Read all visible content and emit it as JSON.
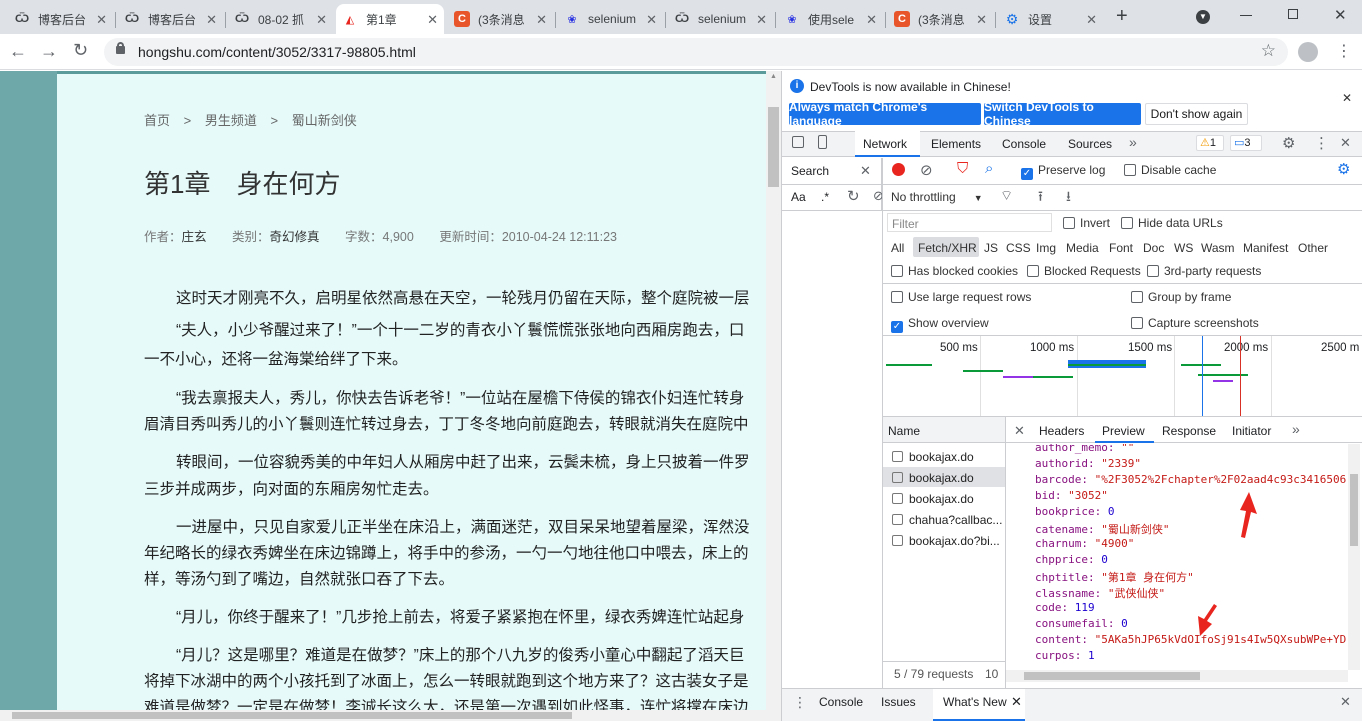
{
  "browser": {
    "tabs": [
      {
        "label": "博客后台",
        "icon": "csdn-w-icon"
      },
      {
        "label": "博客后台",
        "icon": "csdn-w-icon"
      },
      {
        "label": "08-02 抓",
        "icon": "csdn-w-icon"
      },
      {
        "label": "第1章",
        "icon": "hongshu-icon"
      },
      {
        "label": "(3条消息",
        "icon": "csdn-c-icon"
      },
      {
        "label": "selenium",
        "icon": "baidu-paw-icon"
      },
      {
        "label": "selenium",
        "icon": "csdn-w-icon"
      },
      {
        "label": "使用sele",
        "icon": "baidu-paw-icon"
      },
      {
        "label": "(3条消息",
        "icon": "csdn-c-icon"
      },
      {
        "label": "设置",
        "icon": "gear-icon"
      }
    ],
    "url": "hongshu.com/content/3052/3317-98805.html"
  },
  "page": {
    "breadcrumb": [
      "首页",
      "男生频道",
      "蜀山新剑侠"
    ],
    "breadcrumb_sep": ">",
    "title": "第1章　身在何方",
    "meta": {
      "author_label": "作者：",
      "author": "庄玄",
      "category_label": "类别：",
      "category": "奇幻修真",
      "words_label": "字数：",
      "words": "4,900",
      "updated_label": "更新时间：",
      "updated": "2010-04-24 12:11:23"
    },
    "lines": [
      "这时天才刚亮不久，启明星依然高悬在天空，一轮残月仍留在天际，整个庭院被一层",
      "“夫人，小少爷醒过来了！”一个十一二岁的青衣小丫鬟慌慌张张地向西厢房跑去，口",
      "一不小心，还将一盆海棠给绊了下来。",
      "“我去禀报夫人，秀儿，你快去告诉老爷！”一位站在屋檐下侍侯的锦衣仆妇连忙转身",
      "眉清目秀叫秀儿的小丫鬟则连忙转过身去，丁丁冬冬地向前庭跑去，转眼就消失在庭院中",
      "转眼间，一位容貌秀美的中年妇人从厢房中赶了出来，云鬓未梳，身上只披着一件罗",
      "三步并成两步，向对面的东厢房匆忙走去。",
      "一进屋中，只见自家爱儿正半坐在床沿上，满面迷茫，双目呆呆地望着屋梁，浑然没",
      "年纪略长的绿衣秀婢坐在床边锦蹲上，将手中的参汤，一勺一勺地往他口中喂去，床上的",
      "样，等汤勺到了嘴边，自然就张口吞了下去。",
      "“月儿，你终于醒来了！”几步抢上前去，将爱子紧紧抱在怀里，绿衣秀婢连忙站起身",
      "“月儿？这是哪里？难道是在做梦？”床上的那个八九岁的俊秀小童心中翻起了滔天巨",
      "将掉下冰湖中的两个小孩托到了冰面上，怎么一转眼就跑到这个地方来了？这古装女子是",
      "难道是做梦？一定是在做梦！李诚长这么大，还是第一次遇到如此怪事，连忙将撑在床边"
    ]
  },
  "devtools": {
    "banner": {
      "text": "DevTools is now available in Chinese!",
      "btn1": "Always match Chrome's language",
      "btn2": "Switch DevTools to Chinese",
      "btn3": "Don't show again"
    },
    "tabs": [
      "Network",
      "Elements",
      "Console",
      "Sources"
    ],
    "warn_count": "1",
    "msg_count": "3",
    "search_label": "Search",
    "search_aa": "Aa",
    "search_regex": ".*",
    "preserve_log": "Preserve log",
    "disable_cache": "Disable cache",
    "throttling": "No throttling",
    "filter_placeholder": "Filter",
    "invert": "Invert",
    "hide_data_urls": "Hide data URLs",
    "types": [
      "All",
      "Fetch/XHR",
      "JS",
      "CSS",
      "Img",
      "Media",
      "Font",
      "Doc",
      "WS",
      "Wasm",
      "Manifest",
      "Other"
    ],
    "has_blocked_cookies": "Has blocked cookies",
    "blocked_requests": "Blocked Requests",
    "third_party": "3rd-party requests",
    "large_rows": "Use large request rows",
    "group_by_frame": "Group by frame",
    "show_overview": "Show overview",
    "capture_screenshots": "Capture screenshots",
    "timeline_ticks": [
      "500 ms",
      "1000 ms",
      "1500 ms",
      "2000 ms",
      "2500 m"
    ],
    "name_header": "Name",
    "requests": [
      "bookajax.do",
      "bookajax.do",
      "bookajax.do",
      "chahua?callbac...",
      "bookajax.do?bi..."
    ],
    "status": "5 / 79 requests",
    "status2": "10",
    "detail_tabs": [
      "Headers",
      "Preview",
      "Response",
      "Initiator"
    ],
    "json": [
      {
        "k": "author_memo: ",
        "v": "\"\""
      },
      {
        "k": "authorid: ",
        "v": "\"2339\""
      },
      {
        "k": "barcode: ",
        "v": "\"%2F3052%2Fchapter%2F02aad4c93c3416506"
      },
      {
        "k": "bid: ",
        "v": "\"3052\""
      },
      {
        "k": "bookprice: ",
        "v": "0"
      },
      {
        "k": "catename: ",
        "v": "\"蜀山新剑侠\""
      },
      {
        "k": "charnum: ",
        "v": "\"4900\""
      },
      {
        "k": "chpprice: ",
        "v": "0"
      },
      {
        "k": "chptitle: ",
        "v": "\"第1章  身在何方\""
      },
      {
        "k": "classname: ",
        "v": "\"武侠仙侠\""
      },
      {
        "k": "code: ",
        "v": "119"
      },
      {
        "k": "consumefail: ",
        "v": "0"
      },
      {
        "k": "content: ",
        "v": "\"5AKa5hJP65kVdOIfoSj91s4Iw5QXsubWPe+YD"
      },
      {
        "k": "curpos: ",
        "v": "1"
      }
    ],
    "drawer_tabs": [
      "Console",
      "Issues",
      "What's New"
    ]
  },
  "colors": {
    "accent": "#1a73e8",
    "page_bg": "#e6fafa",
    "side_bg": "#6fa8a8",
    "arrow": "#e8261f"
  }
}
